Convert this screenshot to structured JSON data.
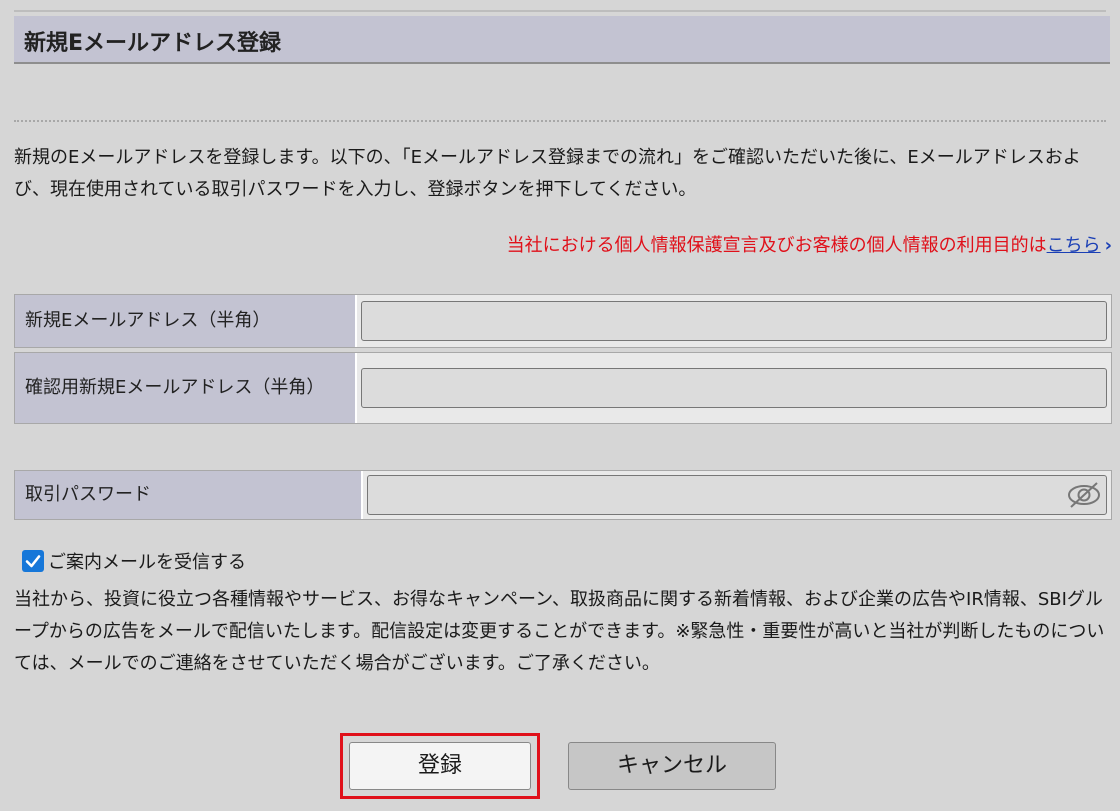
{
  "title": "新規Eメールアドレス登録",
  "intro": "新規のEメールアドレスを登録します。以下の、「Eメールアドレス登録までの流れ」をご確認いただいた後に、Eメールアドレスおよび、現在使用されている取引パスワードを入力し、登録ボタンを押下してください。",
  "privacy": {
    "text": "当社における個人情報保護宣言及びお客様の個人情報の利用目的は",
    "link": "こちら",
    "chevron": "›"
  },
  "form": {
    "new_email_label": "新規Eメールアドレス（半角）",
    "new_email_value": "",
    "confirm_email_label": "確認用新規Eメールアドレス（半角）",
    "confirm_email_value": "",
    "password_label": "取引パスワード",
    "password_value": ""
  },
  "newsletter": {
    "checked": true,
    "label": "ご案内メールを受信する",
    "notice": "当社から、投資に役立つ各種情報やサービス、お得なキャンペーン、取扱商品に関する新着情報、および企業の広告やIR情報、SBIグループからの広告をメールで配信いたします。配信設定は変更することができます。※緊急性・重要性が高いと当社が判断したものについては、メールでのご連絡をさせていただく場合がございます。ご了承ください。"
  },
  "buttons": {
    "register": "登録",
    "cancel": "キャンセル"
  },
  "colors": {
    "accent_red": "#e0101a",
    "link_blue": "#1a3fb5",
    "label_bg": "#c3c3d2",
    "checkbox_blue": "#1677d9"
  },
  "icons": {
    "password_toggle": "eye-slash-icon",
    "checkbox": "check-icon"
  }
}
